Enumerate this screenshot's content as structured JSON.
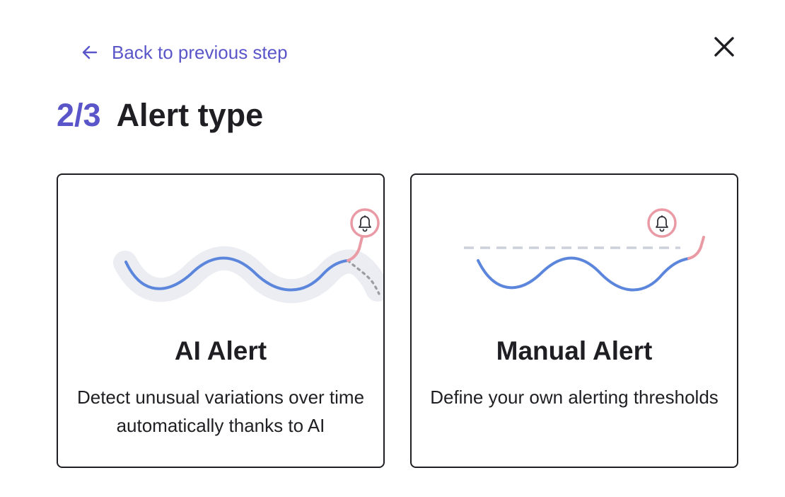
{
  "nav": {
    "back_label": "Back to previous step",
    "back_icon": "arrow-left-icon",
    "close_icon": "close-icon"
  },
  "heading": {
    "step": "2/3",
    "title": "Alert type"
  },
  "options": [
    {
      "title": "AI Alert",
      "description": "Detect unusual variations over time automatically thanks to AI",
      "icon": "bell-icon"
    },
    {
      "title": "Manual Alert",
      "description": "Define your own alerting thresholds",
      "icon": "bell-icon"
    }
  ],
  "colors": {
    "accent": "#5a56c9",
    "line": "#5b86dc",
    "alert": "#e99aa4",
    "band": "#ebedf2",
    "threshold": "#cdd1dc",
    "text": "#1f1f23"
  }
}
